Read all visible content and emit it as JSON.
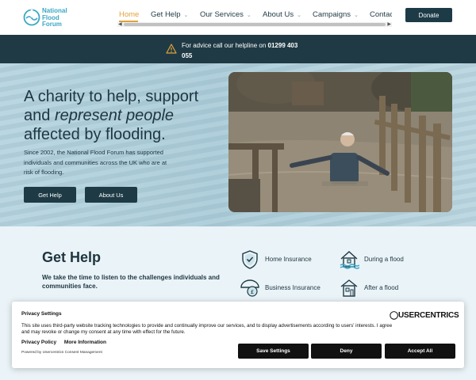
{
  "header": {
    "logo_lines": [
      "National",
      "Flood",
      "Forum"
    ],
    "nav": [
      {
        "label": "Home",
        "active": true,
        "dropdown": false
      },
      {
        "label": "Get Help",
        "active": false,
        "dropdown": true
      },
      {
        "label": "Our Services",
        "active": false,
        "dropdown": true
      },
      {
        "label": "About Us",
        "active": false,
        "dropdown": true
      },
      {
        "label": "Campaigns",
        "active": false,
        "dropdown": true
      },
      {
        "label": "Contac",
        "active": false,
        "dropdown": false
      }
    ],
    "donate_label": "Donate",
    "accent_color": "#e0a23a"
  },
  "helpline": {
    "text": "For advice call our helpline on ",
    "phone": "01299 403 055",
    "icon": "warning-icon"
  },
  "hero": {
    "title_line1": "A charity to help, support",
    "title_and": "and ",
    "title_em": "represent people",
    "title_line3": "affected by flooding.",
    "description": "Since 2002, the National Flood Forum has supported individuals and communities across the UK who are at risk of flooding.",
    "buttons": {
      "get_help": "Get Help",
      "about_us": "About Us"
    }
  },
  "get_help": {
    "title": "Get Help",
    "subtitle": "We take the time to listen to the challenges individuals and communities face.",
    "items": [
      {
        "label": "Home Insurance",
        "icon": "shield-check-icon"
      },
      {
        "label": "During a flood",
        "icon": "flooded-house-icon"
      },
      {
        "label": "Business Insurance",
        "icon": "umbrella-pound-icon"
      },
      {
        "label": "After a flood",
        "icon": "house-repair-icon"
      }
    ]
  },
  "consent": {
    "title": "Privacy Settings",
    "brand": "USERCENTRICS",
    "body": "This site uses third-party website tracking technologies to provide and continually improve our services, and to display advertisements according to users' interests. I agree and may revoke or change my consent at any time with effect for the future.",
    "links": [
      "Privacy Policy",
      "More Information"
    ],
    "powered_by": "Powered by Usercentrics Consent Management",
    "buttons": {
      "save": "Save Settings",
      "deny": "Deny",
      "accept": "Accept All"
    }
  }
}
